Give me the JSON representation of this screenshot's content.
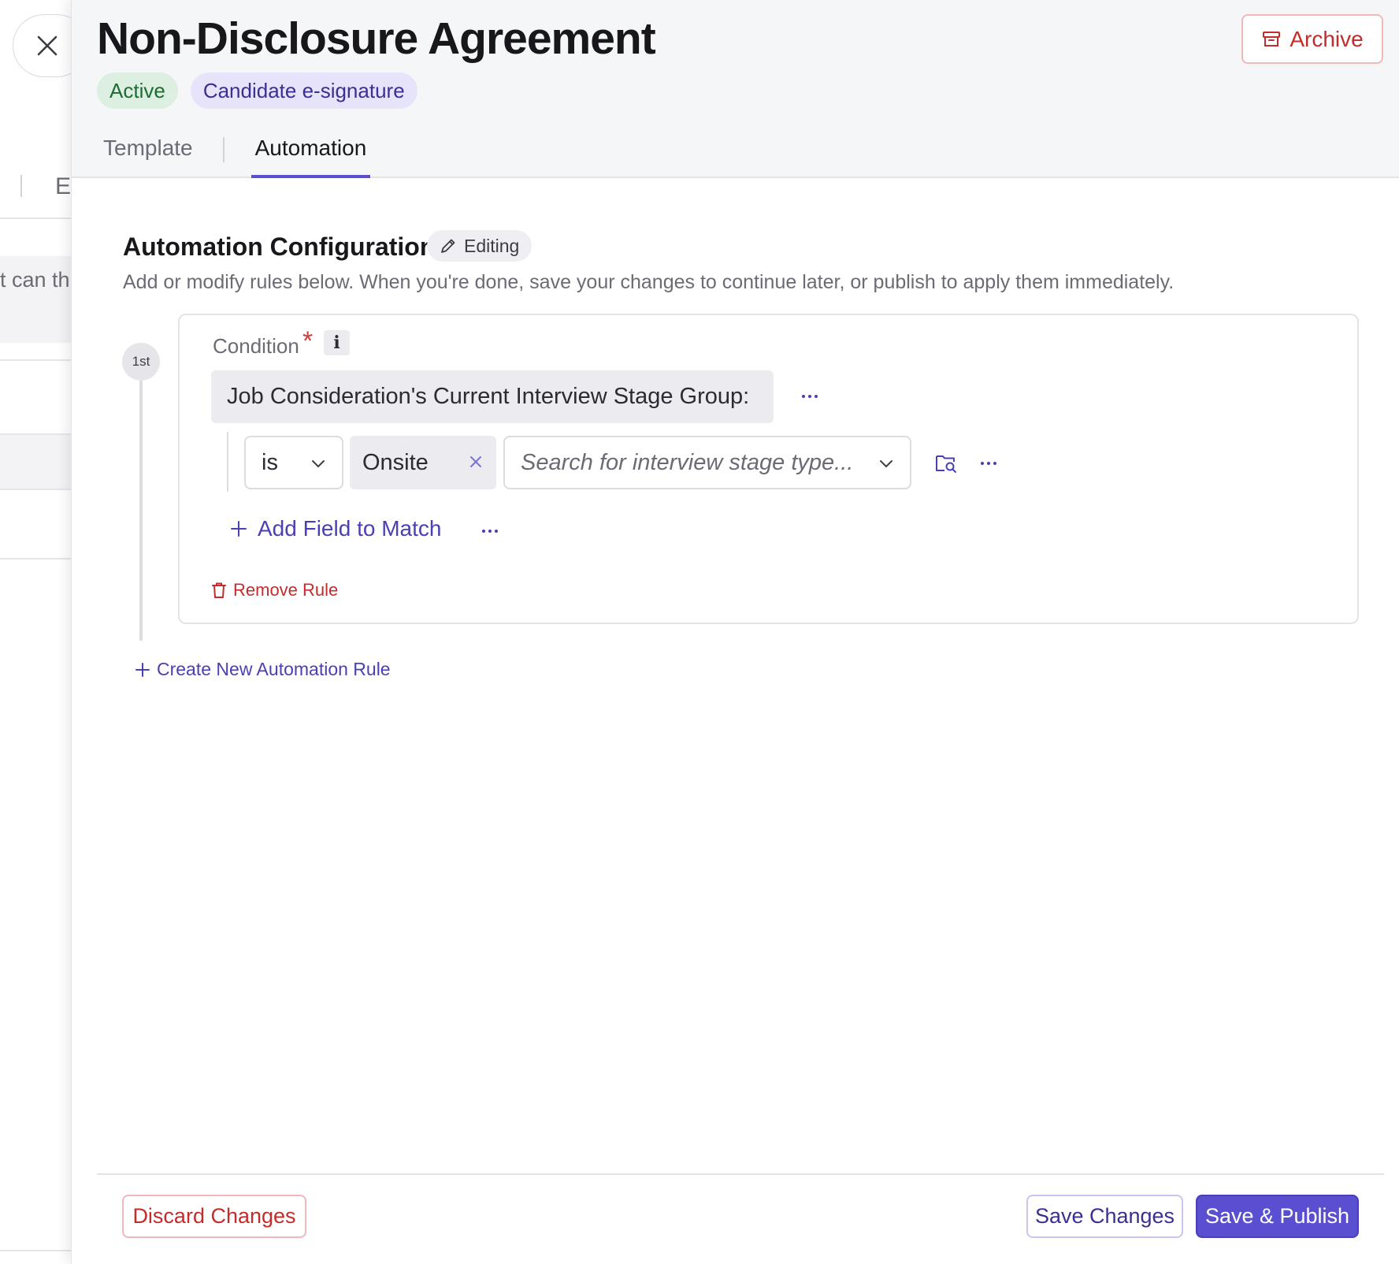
{
  "background": {
    "tab_letter": "E",
    "partial_text": "t can th"
  },
  "header": {
    "title": "Non-Disclosure Agreement",
    "badges": [
      {
        "label": "Active",
        "color": "#1e6b33"
      },
      {
        "label": "Candidate e-signature",
        "color": "#3a2f93"
      }
    ],
    "archive_label": "Archive",
    "tabs": [
      {
        "label": "Template",
        "active": false
      },
      {
        "label": "Automation",
        "active": true
      }
    ]
  },
  "automation": {
    "title": "Automation Configuration",
    "editing_label": "Editing",
    "description": "Add or modify rules below. When you're done, save your changes to continue later, or publish to apply them immediately.",
    "rules": [
      {
        "step": "1st",
        "condition_label": "Condition",
        "required_mark": "*",
        "info_label": "i",
        "field": "Job Consideration's Current Interview Stage Group:",
        "operator": "is",
        "value": "Onsite",
        "search_placeholder": "Search for interview stage type...",
        "add_field_label": "Add Field to Match",
        "remove_label": "Remove Rule"
      }
    ],
    "create_rule_label": "Create New Automation Rule"
  },
  "footer": {
    "discard_label": "Discard Changes",
    "save_label": "Save Changes",
    "publish_label": "Save & Publish"
  },
  "colors": {
    "accent": "#5b4fd1",
    "danger": "#c42b2b",
    "success": "#1e6b33"
  }
}
